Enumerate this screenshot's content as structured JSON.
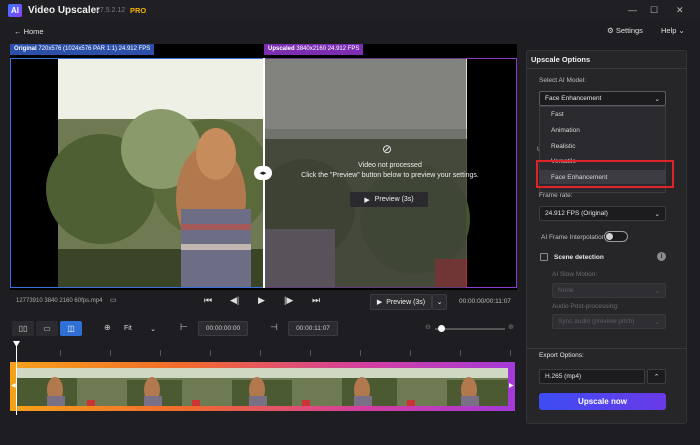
{
  "app": {
    "logo": "AI",
    "title": "Video Upscaler",
    "version": "27.5.2.12",
    "badge": "PRO"
  },
  "nav": {
    "home": "← Home",
    "settings": "Settings",
    "help": "Help"
  },
  "window_controls": {
    "help_arrow": "⌄",
    "minimize": "—",
    "maximize": "☐",
    "close": "✕"
  },
  "preview": {
    "left_label_strong": "Original",
    "left_label_info": "720x576 (1024x576 PAR 1:1) 24.912 FPS",
    "right_label_strong": "Upscaled",
    "right_label_info": "3840x2160 24.912 FPS",
    "not_processed": "Video not processed",
    "hint": "Click the \"Preview\" button below to preview your settings.",
    "preview_button": "Preview (3s)"
  },
  "playback": {
    "filename": "12773910 3840 2160 60fps.mp4",
    "preview_button": "Preview (3s)",
    "timecode": "00:00:00/00:11:07"
  },
  "timeline_toolbar": {
    "zoom_select": "Fit",
    "start_time": "00:00:00:00",
    "end_time": "00:00:11:07"
  },
  "panel": {
    "title": "Upscale Options",
    "model_label": "Select AI Model:",
    "model_value": "Face Enhancement",
    "dropdown_options": [
      "Fast",
      "Animation",
      "Realistic",
      "Versatile",
      "Face Enhancement"
    ],
    "hidden_section_label": "U",
    "frame_rate_label": "Frame rate:",
    "frame_rate_value": "24.912 FPS (Original)",
    "frame_interp_label": "AI Frame Interpolation",
    "scene_detection_label": "Scene detection",
    "slow_motion_label": "AI Slow Motion:",
    "slow_motion_value": "None",
    "audio_label": "Audio Post-processing:",
    "audio_value": "Sync audio (preview pitch)",
    "export_label": "Export Options:",
    "export_value": "H.265 (mp4)",
    "upscale_button": "Upscale now"
  },
  "colors": {
    "accent": "#2f6fd6",
    "highlight": "#e0232a",
    "button_start": "#3d4df2",
    "button_end": "#6a3ae8"
  }
}
